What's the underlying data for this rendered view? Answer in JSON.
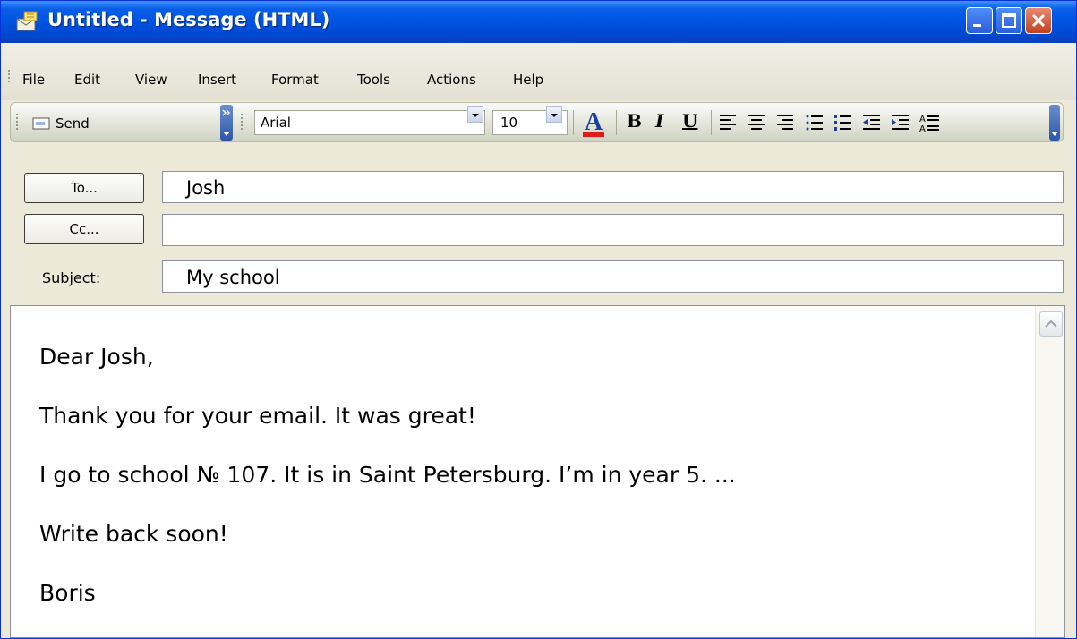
{
  "window": {
    "title": "Untitled - Message (HTML)",
    "accent": "#0055e5"
  },
  "menu": {
    "items": [
      "File",
      "Edit",
      "View",
      "Insert",
      "Format",
      "Tools",
      "Actions",
      "Help"
    ]
  },
  "toolbar": {
    "send_label": "Send",
    "font_name": "Arial",
    "font_size": "10",
    "font_color": "#e01b1b",
    "bold": "B",
    "italic": "I",
    "underline": "U"
  },
  "header": {
    "to_button": "To...",
    "cc_button": "Cc...",
    "subject_label": "Subject:",
    "to_value": "Josh",
    "cc_value": "",
    "subject_value": "My school"
  },
  "body": {
    "paragraphs": [
      "Dear Josh,",
      "Thank you for your email. It was great!",
      "I go to school № 107. It is in Saint Petersburg. I’m in year 5. ...",
      "Write back soon!",
      "Boris"
    ]
  }
}
